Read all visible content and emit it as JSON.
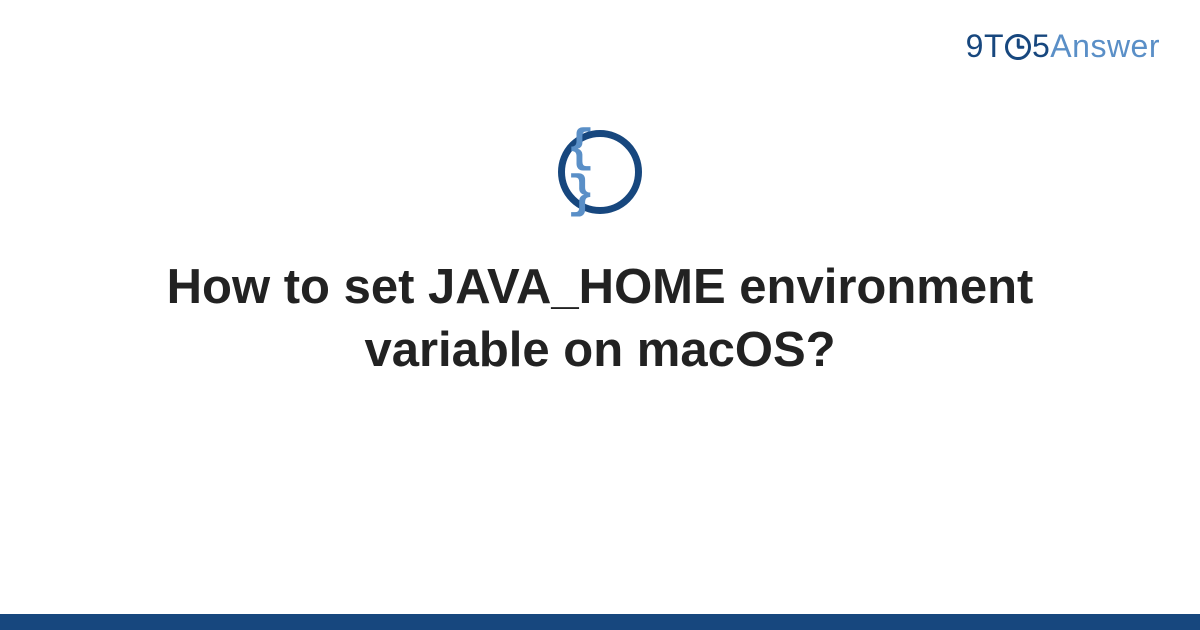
{
  "logo": {
    "part1": "9T",
    "part2": "5",
    "part3": "Answer"
  },
  "icon": {
    "glyph": "{ }"
  },
  "title": "How to set JAVA_HOME environment variable on macOS?",
  "colors": {
    "brand_dark": "#17477e",
    "brand_light": "#5a8fc7"
  }
}
